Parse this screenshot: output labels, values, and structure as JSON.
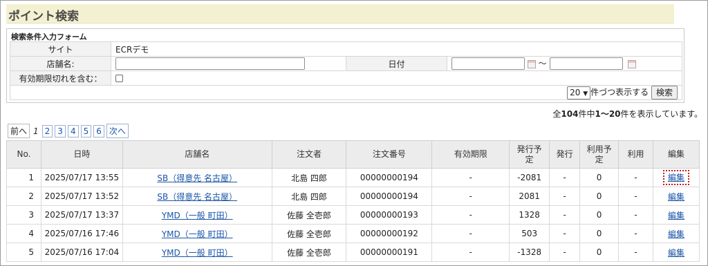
{
  "page_title": "ポイント検索",
  "form": {
    "caption": "検索条件入力フォーム",
    "site_label": "サイト",
    "site_value": "ECRデモ",
    "store_label": "店舗名:",
    "store_value": "",
    "date_label": "日付",
    "date_from": "",
    "date_to": "",
    "date_sep": "〜",
    "expired_label": "有効期限切れを含む：",
    "per_page_value": "20",
    "per_page_suffix": "件づつ表示する",
    "search_button": "検索"
  },
  "summary": {
    "prefix": "全",
    "total": "104",
    "mid": "件中",
    "range": "1〜20",
    "suffix": "件を表示しています。"
  },
  "pager": {
    "prev": "前へ",
    "current": "1",
    "pages": [
      "2",
      "3",
      "4",
      "5",
      "6"
    ],
    "next": "次へ"
  },
  "table": {
    "headers": [
      "No.",
      "日時",
      "店舗名",
      "注文者",
      "注文番号",
      "有効期限",
      "発行予\n定",
      "発行",
      "利用予\n定",
      "利用",
      "編集"
    ],
    "rows": [
      {
        "no": "1",
        "datetime": "2025/07/17 13:55",
        "store": "SB（得意先 名古屋）",
        "customer": "北島 四郎",
        "order": "00000000194",
        "expiry": "-",
        "issue_plan": "-2081",
        "issue": "-",
        "use_plan": "0",
        "use": "-",
        "edit": "編集"
      },
      {
        "no": "2",
        "datetime": "2025/07/17 13:52",
        "store": "SB（得意先 名古屋）",
        "customer": "北島 四郎",
        "order": "00000000194",
        "expiry": "-",
        "issue_plan": "2081",
        "issue": "-",
        "use_plan": "0",
        "use": "-",
        "edit": "編集"
      },
      {
        "no": "3",
        "datetime": "2025/07/17 13:37",
        "store": "YMD（一般 町田）",
        "customer": "佐藤 全壱郎",
        "order": "00000000193",
        "expiry": "-",
        "issue_plan": "1328",
        "issue": "-",
        "use_plan": "0",
        "use": "-",
        "edit": "編集"
      },
      {
        "no": "4",
        "datetime": "2025/07/16 17:46",
        "store": "YMD（一般 町田）",
        "customer": "佐藤 全壱郎",
        "order": "00000000192",
        "expiry": "-",
        "issue_plan": "503",
        "issue": "-",
        "use_plan": "0",
        "use": "-",
        "edit": "編集"
      },
      {
        "no": "5",
        "datetime": "2025/07/16 17:04",
        "store": "YMD（一般 町田）",
        "customer": "佐藤 全壱郎",
        "order": "00000000191",
        "expiry": "-",
        "issue_plan": "-1328",
        "issue": "-",
        "use_plan": "0",
        "use": "-",
        "edit": "編集"
      }
    ]
  },
  "colors": {
    "title_bg": "#f4f1d2",
    "link": "#1a55a8",
    "highlight": "#c0171c"
  }
}
